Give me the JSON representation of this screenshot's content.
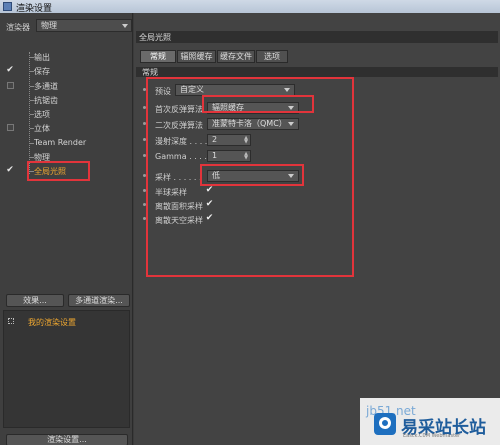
{
  "window": {
    "title": "渲染设置"
  },
  "left_panel": {
    "renderer_label": "渲染器",
    "renderer_value": "物理",
    "tree_items": [
      {
        "label": "输出",
        "checked": false,
        "checkbox": false
      },
      {
        "label": "保存",
        "checked": true,
        "checkbox": false
      },
      {
        "label": "多通道",
        "checked": false,
        "checkbox": true
      },
      {
        "label": "抗锯齿",
        "checked": false,
        "checkbox": false
      },
      {
        "label": "选项",
        "checked": false,
        "checkbox": false
      },
      {
        "label": "立体",
        "checked": false,
        "checkbox": true
      },
      {
        "label": "Team Render",
        "checked": false,
        "checkbox": false
      },
      {
        "label": "物理",
        "checked": false,
        "checkbox": false
      },
      {
        "label": "全局光照",
        "checked": true,
        "checkbox": false
      }
    ],
    "effect_button": "效果...",
    "multipass_button": "多通道渲染...",
    "settings_item": "我的渲染设置",
    "render_settings_button": "渲染设置..."
  },
  "right_panel": {
    "header": "全局光照",
    "tabs": [
      "常规",
      "辐照缓存",
      "缓存文件",
      "选项"
    ],
    "active_tab": "常规",
    "section": "常规",
    "fields": {
      "preset_label": "预设",
      "preset_value": "自定义",
      "primary_label": "首次反弹算法",
      "primary_value": "辐照缓存",
      "secondary_label": "二次反弹算法",
      "secondary_value": "准蒙特卡洛（QMC）",
      "depth_label": "漫射深度 . . . .",
      "depth_value": "2",
      "gamma_label": "Gamma . . . .",
      "gamma_value": "1",
      "sampling_label": "采样 . . . . . .",
      "sampling_value": "低",
      "hemisphere_label": "半球采样",
      "area_label": "离散面积采样",
      "sky_label": "离散天空采样"
    }
  },
  "watermark": {
    "domain_text": "jb51.net",
    "title": "易采站长站",
    "subtitle": "Easck.C0M  Webmaster"
  },
  "colors": {
    "highlight_red": "#e2343b",
    "active_orange": "#f0a830"
  }
}
